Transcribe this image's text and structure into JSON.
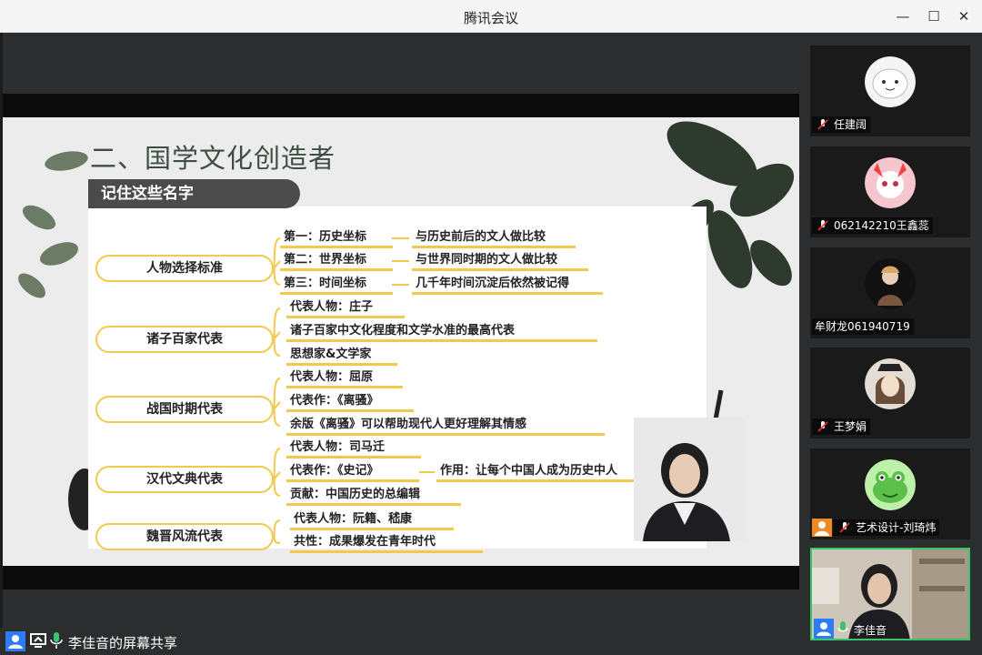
{
  "window": {
    "title": "腾讯会议",
    "controls": {
      "minimize": "—",
      "maximize": "☐",
      "close": "✕"
    }
  },
  "slide": {
    "title": "二、国学文化创造者",
    "section_label": "记住这些名字",
    "categories": [
      {
        "label": "人物选择标准",
        "items": [
          "第一：历史坐标",
          "第二：世界坐标",
          "第三：时间坐标"
        ],
        "tails": [
          "与历史前后的文人做比较",
          "与世界同时期的文人做比较",
          "几千年时间沉淀后依然被记得"
        ]
      },
      {
        "label": "诸子百家代表",
        "items": [
          "代表人物：庄子",
          "诸子百家中文化程度和文学水准的最高代表",
          "思想家&文学家"
        ]
      },
      {
        "label": "战国时期代表",
        "items": [
          "代表人物：屈原",
          "代表作：《离骚》",
          "余版《离骚》可以帮助现代人更好理解其情感"
        ]
      },
      {
        "label": "汉代文典代表",
        "items": [
          "代表人物：司马迁",
          "代表作：《史记》",
          "贡献：中国历史的总编辑"
        ],
        "extra": "作用：让每个中国人成为历史中人"
      },
      {
        "label": "魏晋风流代表",
        "items": [
          "代表人物：阮籍、嵇康",
          "共性：成果爆发在青年时代"
        ]
      }
    ]
  },
  "share_bar": {
    "label": "李佳音的屏幕共享"
  },
  "participants": [
    {
      "name": "任建阔",
      "muted": true
    },
    {
      "name": "062142210王鑫蕊",
      "muted": true
    },
    {
      "name": "牟财龙061940719",
      "muted": false
    },
    {
      "name": "王梦娟",
      "muted": true
    },
    {
      "name": "艺术设计-刘琦炜",
      "muted": true
    },
    {
      "name": "李佳音",
      "muted": false,
      "active": true
    }
  ],
  "colors": {
    "accent": "#f2c94c",
    "active_border": "#3bc46a",
    "badge": "#f08a24"
  }
}
